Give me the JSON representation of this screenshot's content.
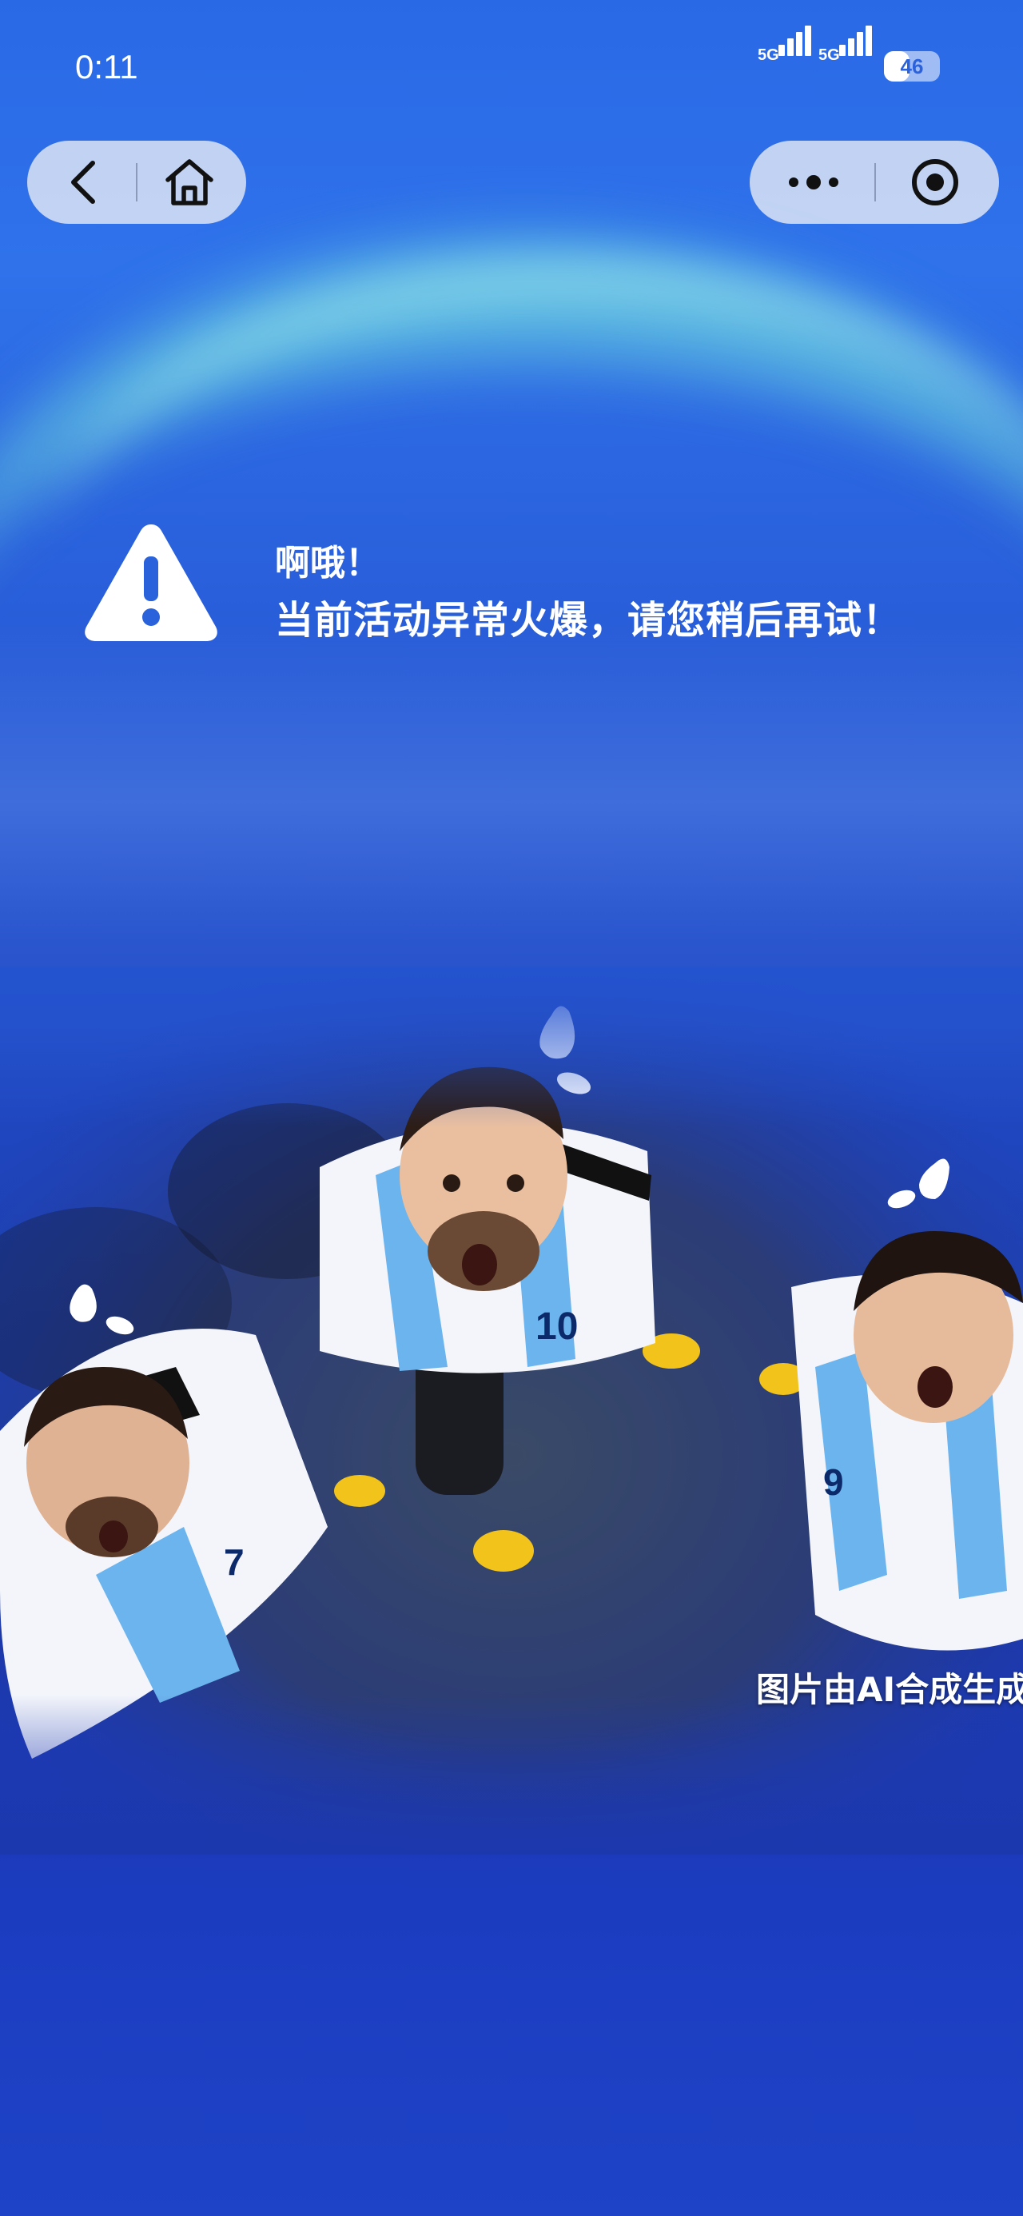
{
  "status_bar": {
    "time": "0:11",
    "network_1": "5G",
    "network_2": "5G",
    "battery": "46"
  },
  "capsule_left": {
    "back_icon": "chevron-left-icon",
    "home_icon": "home-icon"
  },
  "capsule_right": {
    "more_icon": "more-dots-icon",
    "close_icon": "target-circle-icon"
  },
  "notice": {
    "icon": "warning-triangle-icon",
    "title": "啊哦！",
    "message": "当前活动异常火爆，请您稍后再试！"
  },
  "hero": {
    "jersey_numbers": [
      "7",
      "10",
      "9"
    ],
    "ai_note": "图片由AI合成生成"
  },
  "colors": {
    "background_top": "#2a69e6",
    "background_bottom": "#1e43c6",
    "glow": "#78ebdc",
    "jersey_blue": "#6cb4ee",
    "boot_yellow": "#f2c31a"
  }
}
